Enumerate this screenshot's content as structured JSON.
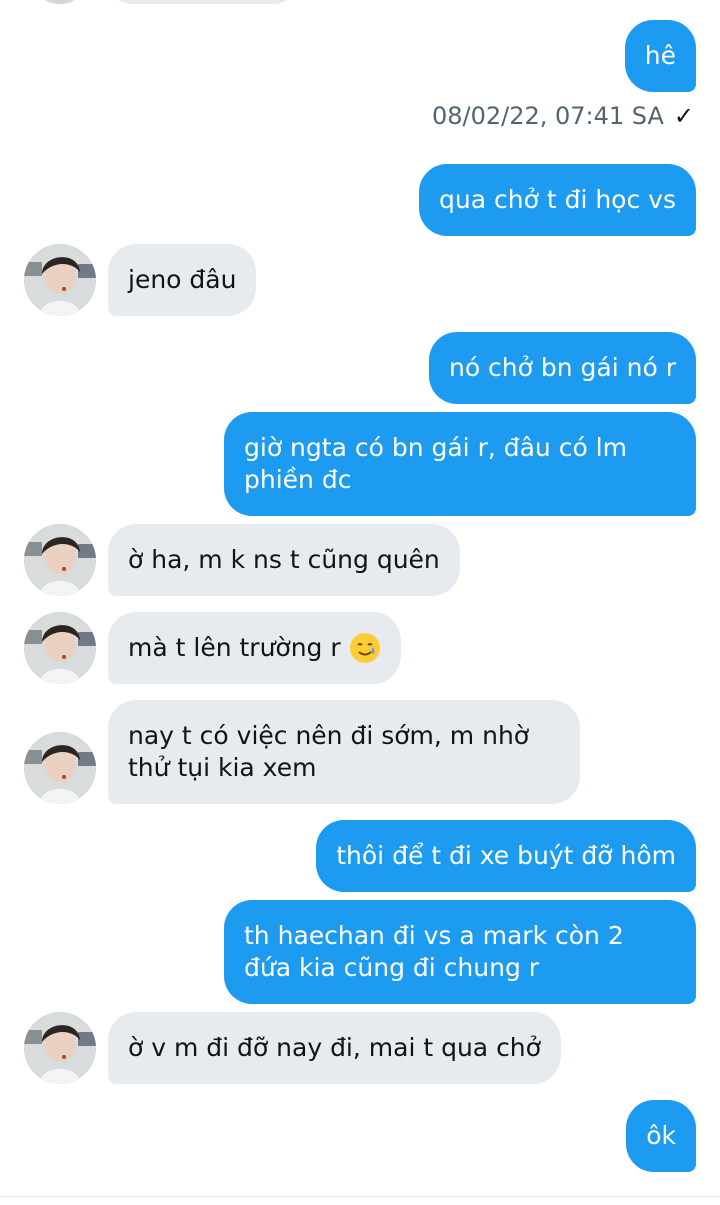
{
  "timestamp": {
    "text": "08/02/22, 07:41 SA",
    "check": "✓"
  },
  "messages": [
    {
      "side": "out",
      "text": "hê"
    },
    {
      "side": "out",
      "text": "qua chở t đi học vs"
    },
    {
      "side": "in",
      "text": "jeno đâu"
    },
    {
      "side": "out",
      "text": "nó chở bn gái nó r"
    },
    {
      "side": "out",
      "text": "giờ ngta có bn gái r, đâu có lm phiền đc"
    },
    {
      "side": "in",
      "text": "ờ ha, m k ns t cũng quên"
    },
    {
      "side": "in",
      "text": "mà t lên trường r"
    },
    {
      "side": "in",
      "text": "nay t có việc nên đi sớm, m nhờ thử tụi kia xem"
    },
    {
      "side": "out",
      "text": "thôi để t đi xe buýt đỡ hôm"
    },
    {
      "side": "out",
      "text": "th haechan đi vs a mark còn 2 đứa kia cũng đi chung r"
    },
    {
      "side": "in",
      "text": "ờ v m đi đỡ nay đi, mai t qua chở"
    },
    {
      "side": "out",
      "text": "ôk"
    }
  ],
  "emoji": {
    "name": "smiling-face-with-tear-icon"
  },
  "avatar": {
    "name": "contact-avatar"
  },
  "colors": {
    "outgoing": "#1d9bf0",
    "incoming": "#e7ebef",
    "timestamp": "#536471"
  }
}
